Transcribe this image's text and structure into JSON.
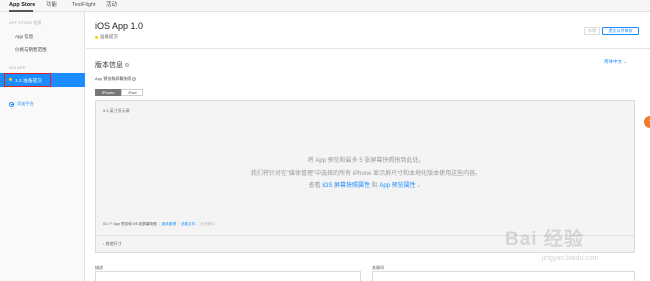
{
  "nav": {
    "tabs": [
      "App Store",
      "功能",
      "TestFlight",
      "活动"
    ]
  },
  "sidebar": {
    "group1": "APP STORE 信息",
    "items": [
      "App 信息",
      "价格与销售范围"
    ],
    "group2": "IOS APP",
    "selected": "1.0 准备提交",
    "add_platform": "添加平台"
  },
  "header": {
    "title": "iOS App 1.0",
    "status": "准备提交",
    "save_label": "存储",
    "submit_label": "提交以供审核"
  },
  "version_info": {
    "title": "版本信息",
    "language": "简体中文 ⌄",
    "preview_label": "App 预览和屏幕快照",
    "devices": [
      "iPhone",
      "iPad"
    ],
    "size_label": "5.5 英寸显示屏",
    "drop_line1": "将 App 预览和最多 5 张屏幕快照拖到此处。",
    "drop_line2": "我们将针对在\"媒体管理\"中选择的所有 iPhone 显示屏尺寸和本地化版本使用这些内容。",
    "drop_line3_pre": "查看",
    "drop_link1": "iOS 屏幕快照属性",
    "drop_line3_mid": "和",
    "drop_link2": "App 预览属性",
    "drop_line3_post": "。",
    "tools_count": "0/1 个 App 预览和 0/5 张屏幕快照",
    "tools_media": "媒体管理",
    "tools_choose": "选取文件",
    "tools_delete": "全部删除",
    "other_sizes": "其他尺寸"
  },
  "fields": {
    "description_label": "描述",
    "keywords_label": "关键词"
  },
  "watermark": {
    "brand": "Bai 经验",
    "sub": "jingyan.baidu.com"
  }
}
